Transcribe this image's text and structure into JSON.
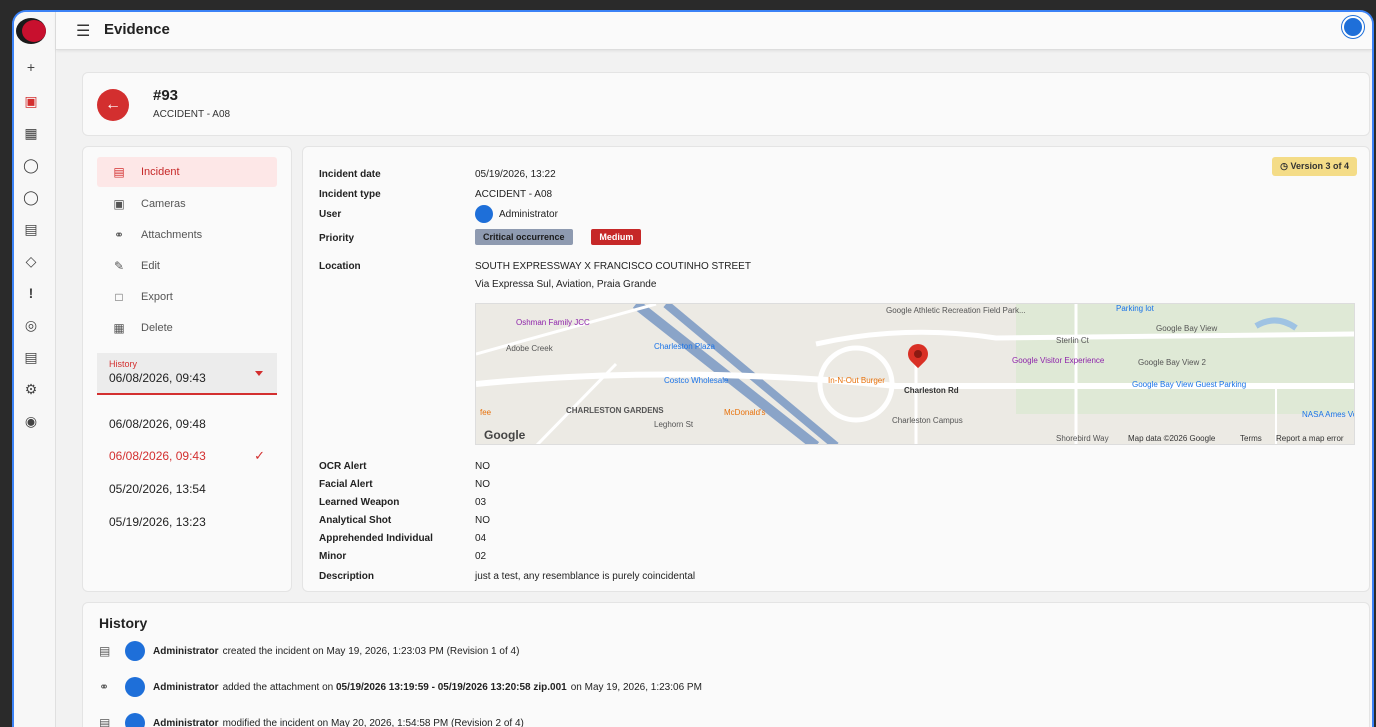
{
  "topbar": {
    "title": "Evidence"
  },
  "incident": {
    "number": "#93",
    "type": "ACCIDENT - A08"
  },
  "nav": [
    {
      "label": "Incident",
      "icon": "document-icon"
    },
    {
      "label": "Cameras",
      "icon": "camera-icon"
    },
    {
      "label": "Attachments",
      "icon": "paperclip-icon"
    },
    {
      "label": "Edit",
      "icon": "pencil-icon"
    },
    {
      "label": "Export",
      "icon": "export-icon"
    },
    {
      "label": "Delete",
      "icon": "trash-icon"
    }
  ],
  "history_select": {
    "label": "History",
    "value": "06/08/2026, 09:43",
    "options": [
      "06/08/2026, 09:48",
      "06/08/2026, 09:43",
      "05/20/2026, 13:54",
      "05/19/2026, 13:23"
    ],
    "selected_index": 1
  },
  "details": {
    "version": "Version 3 of 4",
    "incident_date_label": "Incident date",
    "incident_date": "05/19/2026, 13:22",
    "incident_type_label": "Incident type",
    "incident_type": "ACCIDENT - A08",
    "user_label": "User",
    "user": "Administrator",
    "priority_label": "Priority",
    "priority_1": "Critical occurrence",
    "priority_2": "Medium",
    "location_label": "Location",
    "location_line1": "SOUTH EXPRESSWAY X FRANCISCO COUTINHO STREET",
    "location_line2": "Via Expressa Sul, Aviation, Praia Grande",
    "ocr_label": "OCR Alert",
    "ocr": "NO",
    "facial_label": "Facial Alert",
    "facial": "NO",
    "weapon_label": "Learned Weapon",
    "weapon": "03",
    "shot_label": "Analytical Shot",
    "shot": "NO",
    "apprehended_label": "Apprehended Individual",
    "apprehended": "04",
    "minor_label": "Minor",
    "minor": "02",
    "description_label": "Description",
    "description": "just a test, any resemblance is purely coincidental"
  },
  "map": {
    "labels": {
      "oshman": "Oshman Family JCC",
      "charleston_plaza": "Charleston Plaza",
      "costco": "Costco Wholesale",
      "innout": "In-N-Out Burger",
      "mcdonalds": "McDonald's",
      "charleston_gardens": "CHARLESTON GARDENS",
      "athletic": "Google Athletic Recreation Field Park...",
      "visitor": "Google Visitor Experience",
      "charleston_rd": "Charleston Rd",
      "charleston_campus": "Charleston Campus",
      "parking": "Parking lot",
      "bayview": "Google Bay View",
      "bayview2": "Google Bay View 2",
      "guest": "Google Bay View Guest Parking",
      "nasa": "NASA Ames Volleyball",
      "sterlin": "Sterlin Ct",
      "adobe": "Adobe Creek",
      "leghorn": "Leghorn St",
      "fee": "fee",
      "google": "Google",
      "footer_data": "Map data ©2026 Google",
      "footer_terms": "Terms",
      "footer_report": "Report a map error",
      "shorebird": "Shorebird Way"
    }
  },
  "history": {
    "title": "History",
    "entries": [
      {
        "user": "Administrator",
        "text": "created the incident on May 19, 2026, 1:23:03 PM (Revision 1 of 4)"
      },
      {
        "user": "Administrator",
        "text_before": "added the attachment on",
        "bold": "05/19/2026 13:19:59 - 05/19/2026 13:20:58 zip.001",
        "text_after": "on May 19, 2026, 1:23:06 PM"
      },
      {
        "user": "Administrator",
        "text": "modified the incident on May 20, 2026, 1:54:58 PM (Revision 2 of 4)"
      }
    ]
  },
  "colors": {
    "accent": "#d32f2f",
    "active_bg": "#fde7e7",
    "version_bg": "#f4dc87",
    "priority_gray": "#8e9ab0",
    "priority_red": "#c62828"
  }
}
